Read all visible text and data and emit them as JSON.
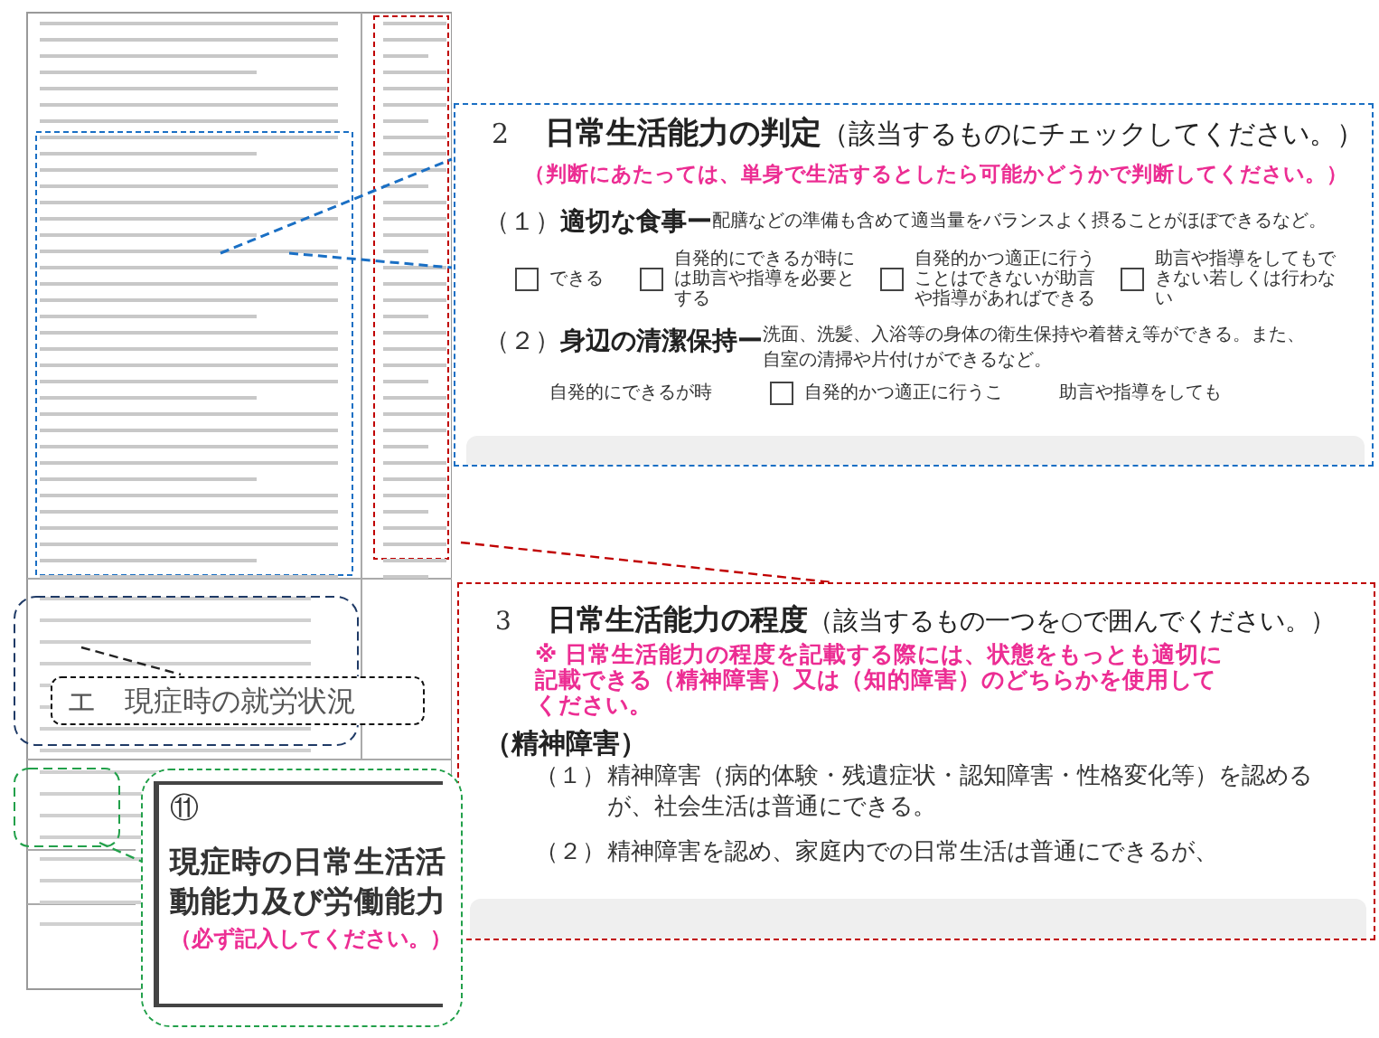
{
  "judgment_callout": {
    "number": "2",
    "title": "日常生活能力の判定",
    "title_note": "（該当するものにチェックしてください。）",
    "instruction": "（判断にあたっては、単身で生活するとしたら可能かどうかで判断してください。）",
    "items": [
      {
        "number": "（１）",
        "name": "適切な食事ー",
        "description": "配膳などの準備も含めて適当量をバランスよく摂ることがほぼできるなど。",
        "options": [
          {
            "label": "できる",
            "checked": false
          },
          {
            "label": "自発的にできるが時には助言や指導を必要とする",
            "checked": false
          },
          {
            "label": "自発的かつ適正に行うことはできないが助言や指導があればできる",
            "checked": false
          },
          {
            "label": "助言や指導をしてもできない若しくは行わない",
            "checked": false
          }
        ]
      },
      {
        "number": "（２）",
        "name": "身辺の清潔保持ー",
        "description": "洗面、洗髪、入浴等の身体の衛生保持や着替え等ができる。また、自室の清掃や片付けができるなど。",
        "options": [
          {
            "label": "自発的にできるが時"
          },
          {
            "label": "自発的かつ適正に行うこ",
            "checked": false
          },
          {
            "label": "助言や指導をしても"
          }
        ]
      }
    ]
  },
  "degree_callout": {
    "number": "3",
    "title": "日常生活能力の程度",
    "title_note": "（該当するもの一つを○で囲んでください。）",
    "warning": "※ 日常生活能力の程度を記載する際には、状態をもっとも適切に記載できる（精神障害）又は（知的障害）のどちらかを使用してください。",
    "category": "（精神障害）",
    "levels": [
      {
        "number": "（１）",
        "text": "精神障害（病的体験・残遺症状・認知障害・性格変化等）を認めるが、社会生活は普通にできる。"
      },
      {
        "number": "（２）",
        "text": "精神障害を認め、家庭内での日常生活は普通にできるが、"
      }
    ]
  },
  "employment_callout": {
    "title": "エ　現症時の就労状況"
  },
  "ability_callout": {
    "number": "⑪",
    "title": "現症時の日常生活活動能力及び労働能力",
    "note": "（必ず記入してください。）"
  }
}
